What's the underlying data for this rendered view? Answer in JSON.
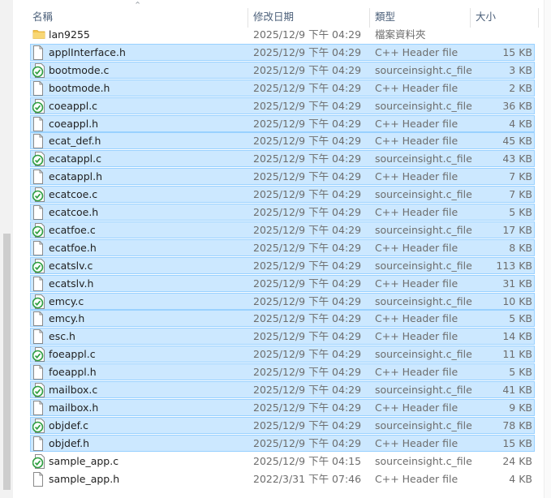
{
  "header": {
    "name": "名稱",
    "modified": "修改日期",
    "type": "類型",
    "size": "大小",
    "sort_arrow": "⌃"
  },
  "files": [
    {
      "name": "lan9255",
      "modified": "2025/12/9 下午 04:29",
      "type": "檔案資料夾",
      "size": "",
      "icon": "folder-icon",
      "selected": false
    },
    {
      "name": "applInterface.h",
      "modified": "2025/12/9 下午 04:29",
      "type": "C++ Header file",
      "size": "15 KB",
      "icon": "header-file-icon",
      "selected": true
    },
    {
      "name": "bootmode.c",
      "modified": "2025/12/9 下午 04:29",
      "type": "sourceinsight.c_file",
      "size": "3 KB",
      "icon": "c-source-file-icon",
      "selected": true
    },
    {
      "name": "bootmode.h",
      "modified": "2025/12/9 下午 04:29",
      "type": "C++ Header file",
      "size": "2 KB",
      "icon": "header-file-icon",
      "selected": true
    },
    {
      "name": "coeappl.c",
      "modified": "2025/12/9 下午 04:29",
      "type": "sourceinsight.c_file",
      "size": "36 KB",
      "icon": "c-source-file-icon",
      "selected": true
    },
    {
      "name": "coeappl.h",
      "modified": "2025/12/9 下午 04:29",
      "type": "C++ Header file",
      "size": "4 KB",
      "icon": "header-file-icon",
      "selected": true
    },
    {
      "name": "ecat_def.h",
      "modified": "2025/12/9 下午 04:29",
      "type": "C++ Header file",
      "size": "45 KB",
      "icon": "header-file-icon",
      "selected": true
    },
    {
      "name": "ecatappl.c",
      "modified": "2025/12/9 下午 04:29",
      "type": "sourceinsight.c_file",
      "size": "43 KB",
      "icon": "c-source-file-icon",
      "selected": true
    },
    {
      "name": "ecatappl.h",
      "modified": "2025/12/9 下午 04:29",
      "type": "C++ Header file",
      "size": "7 KB",
      "icon": "header-file-icon",
      "selected": true
    },
    {
      "name": "ecatcoe.c",
      "modified": "2025/12/9 下午 04:29",
      "type": "sourceinsight.c_file",
      "size": "7 KB",
      "icon": "c-source-file-icon",
      "selected": true
    },
    {
      "name": "ecatcoe.h",
      "modified": "2025/12/9 下午 04:29",
      "type": "C++ Header file",
      "size": "5 KB",
      "icon": "header-file-icon",
      "selected": true
    },
    {
      "name": "ecatfoe.c",
      "modified": "2025/12/9 下午 04:29",
      "type": "sourceinsight.c_file",
      "size": "17 KB",
      "icon": "c-source-file-icon",
      "selected": true
    },
    {
      "name": "ecatfoe.h",
      "modified": "2025/12/9 下午 04:29",
      "type": "C++ Header file",
      "size": "8 KB",
      "icon": "header-file-icon",
      "selected": true
    },
    {
      "name": "ecatslv.c",
      "modified": "2025/12/9 下午 04:29",
      "type": "sourceinsight.c_file",
      "size": "113 KB",
      "icon": "c-source-file-icon",
      "selected": true
    },
    {
      "name": "ecatslv.h",
      "modified": "2025/12/9 下午 04:29",
      "type": "C++ Header file",
      "size": "31 KB",
      "icon": "header-file-icon",
      "selected": true
    },
    {
      "name": "emcy.c",
      "modified": "2025/12/9 下午 04:29",
      "type": "sourceinsight.c_file",
      "size": "10 KB",
      "icon": "c-source-file-icon",
      "selected": true
    },
    {
      "name": "emcy.h",
      "modified": "2025/12/9 下午 04:29",
      "type": "C++ Header file",
      "size": "5 KB",
      "icon": "header-file-icon",
      "selected": true
    },
    {
      "name": "esc.h",
      "modified": "2025/12/9 下午 04:29",
      "type": "C++ Header file",
      "size": "14 KB",
      "icon": "header-file-icon",
      "selected": true
    },
    {
      "name": "foeappl.c",
      "modified": "2025/12/9 下午 04:29",
      "type": "sourceinsight.c_file",
      "size": "11 KB",
      "icon": "c-source-file-icon",
      "selected": true
    },
    {
      "name": "foeappl.h",
      "modified": "2025/12/9 下午 04:29",
      "type": "C++ Header file",
      "size": "5 KB",
      "icon": "header-file-icon",
      "selected": true
    },
    {
      "name": "mailbox.c",
      "modified": "2025/12/9 下午 04:29",
      "type": "sourceinsight.c_file",
      "size": "41 KB",
      "icon": "c-source-file-icon",
      "selected": true
    },
    {
      "name": "mailbox.h",
      "modified": "2025/12/9 下午 04:29",
      "type": "C++ Header file",
      "size": "9 KB",
      "icon": "header-file-icon",
      "selected": true
    },
    {
      "name": "objdef.c",
      "modified": "2025/12/9 下午 04:29",
      "type": "sourceinsight.c_file",
      "size": "78 KB",
      "icon": "c-source-file-icon",
      "selected": true
    },
    {
      "name": "objdef.h",
      "modified": "2025/12/9 下午 04:29",
      "type": "C++ Header file",
      "size": "15 KB",
      "icon": "header-file-icon",
      "selected": true
    },
    {
      "name": "sample_app.c",
      "modified": "2025/12/9 下午 04:15",
      "type": "sourceinsight.c_file",
      "size": "24 KB",
      "icon": "c-source-file-icon",
      "selected": false
    },
    {
      "name": "sample_app.h",
      "modified": "2022/3/31 下午 07:46",
      "type": "C++ Header file",
      "size": "4 KB",
      "icon": "header-file-icon",
      "selected": false
    }
  ],
  "colors": {
    "selection_fill": "#cce8ff",
    "selection_border": "#99d1ff",
    "folder": "#f4c44e",
    "c_file_badge": "#2e9e3f",
    "header_text": "#4c607a"
  }
}
